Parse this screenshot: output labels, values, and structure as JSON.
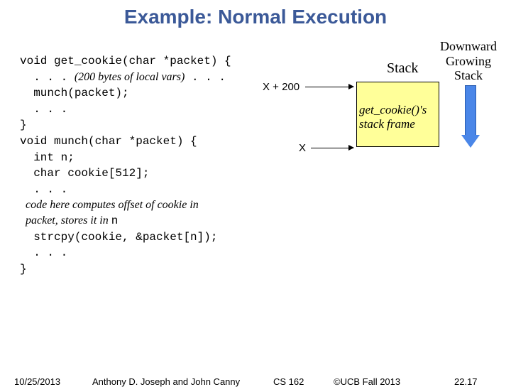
{
  "title": "Example: Normal Execution",
  "code": {
    "l1a": "void get_cookie(char *packet) {",
    "l2a": "  . . . ",
    "l2b": "(200 bytes of local vars)",
    "l2c": " . . .",
    "l3": "  munch(packet);",
    "l4": "  . . .",
    "l5": "}",
    "l6": "void munch(char *packet) {",
    "l7": "  int n;",
    "l8": "  char cookie[512];",
    "l9": "  . . .",
    "l10": "  code here computes offset of cookie in",
    "l11": "  packet, stores it in ",
    "l11b": "n",
    "l12": "  strcpy(cookie, &packet[n]);",
    "l13": "  . . .",
    "l14": "}"
  },
  "stack_label": "Stack",
  "dgs1": "Downward",
  "dgs2": "Growing",
  "dgs3": "Stack",
  "frame1": "get_cookie()'s",
  "frame2": "stack frame",
  "x200": "X + 200",
  "x": "X",
  "footer": {
    "date": "10/25/2013",
    "authors": "Anthony D. Joseph and John Canny",
    "course": "CS 162",
    "copyright": "©UCB Fall 2013",
    "page": "22.17"
  }
}
